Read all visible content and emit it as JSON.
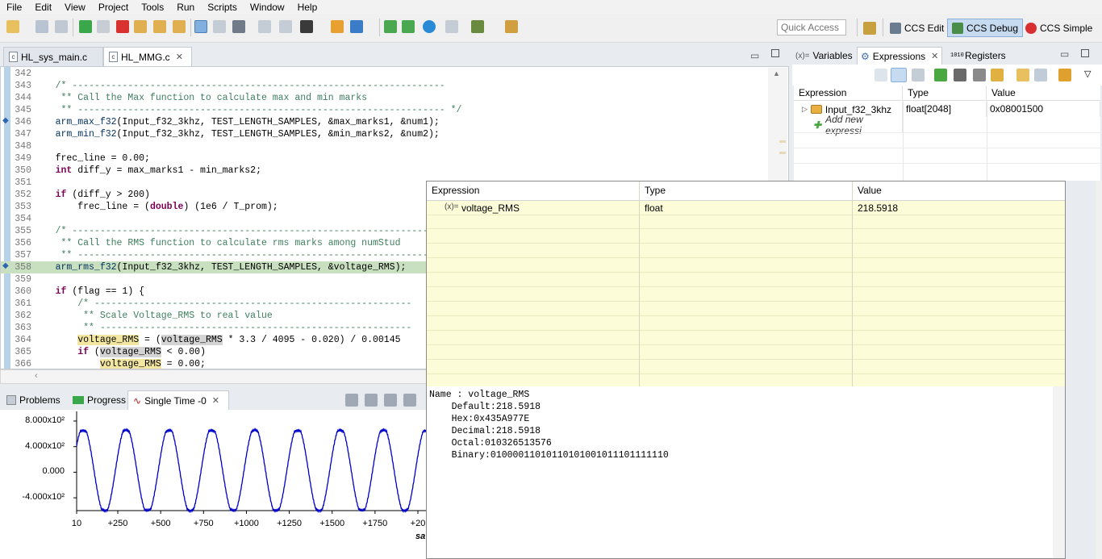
{
  "menu": [
    "File",
    "Edit",
    "View",
    "Project",
    "Tools",
    "Run",
    "Scripts",
    "Window",
    "Help"
  ],
  "toolbar": {
    "quick_access_placeholder": "Quick Access"
  },
  "perspectives": [
    {
      "label": "CCS Edit",
      "active": false
    },
    {
      "label": "CCS Debug",
      "active": true
    },
    {
      "label": "CCS Simple",
      "active": false
    }
  ],
  "editor": {
    "tabs": [
      {
        "label": "HL_sys_main.c",
        "active": false
      },
      {
        "label": "HL_MMG.c",
        "active": true
      }
    ]
  },
  "code": [
    {
      "n": "342",
      "segs": [
        {
          "t": ""
        }
      ]
    },
    {
      "n": "343",
      "segs": [
        {
          "t": "    /* -------------------------------------------------------------------",
          "c": "cmt"
        }
      ]
    },
    {
      "n": "344",
      "segs": [
        {
          "t": "     ** Call the Max function to calculate max and min marks",
          "c": "cmt"
        }
      ]
    },
    {
      "n": "345",
      "segs": [
        {
          "t": "     ** ------------------------------------------------------------------ */",
          "c": "cmt"
        }
      ]
    },
    {
      "n": "346",
      "segs": [
        {
          "t": "    arm_max_f32",
          "c": "fn"
        },
        {
          "t": "(Input_f32_3khz, TEST_LENGTH_SAMPLES, &max_marks1, &num1);"
        }
      ]
    },
    {
      "n": "347",
      "segs": [
        {
          "t": "    arm_min_f32",
          "c": "fn"
        },
        {
          "t": "(Input_f32_3khz, TEST_LENGTH_SAMPLES, &min_marks2, &num2);"
        }
      ]
    },
    {
      "n": "348",
      "segs": [
        {
          "t": ""
        }
      ]
    },
    {
      "n": "349",
      "segs": [
        {
          "t": "    frec_line = 0.00;"
        }
      ]
    },
    {
      "n": "350",
      "segs": [
        {
          "t": "    "
        },
        {
          "t": "int",
          "c": "kw"
        },
        {
          "t": " diff_y = max_marks1 - min_marks2;"
        }
      ]
    },
    {
      "n": "351",
      "segs": [
        {
          "t": ""
        }
      ]
    },
    {
      "n": "352",
      "segs": [
        {
          "t": "    "
        },
        {
          "t": "if",
          "c": "kw"
        },
        {
          "t": " (diff_y > 200)"
        }
      ]
    },
    {
      "n": "353",
      "segs": [
        {
          "t": "        frec_line = ("
        },
        {
          "t": "double",
          "c": "kw"
        },
        {
          "t": ") (1e6 / T_prom);"
        }
      ]
    },
    {
      "n": "354",
      "segs": [
        {
          "t": ""
        }
      ]
    },
    {
      "n": "355",
      "segs": [
        {
          "t": "    /* -------------------------------------------------------------------",
          "c": "cmt"
        }
      ]
    },
    {
      "n": "356",
      "segs": [
        {
          "t": "     ** Call the RMS function to calculate rms marks among numStud",
          "c": "cmt"
        }
      ]
    },
    {
      "n": "357",
      "segs": [
        {
          "t": "     ** ------------------------------------------------------------------",
          "c": "cmt"
        }
      ]
    },
    {
      "n": "358",
      "hl": true,
      "segs": [
        {
          "t": "    arm_rms_f32",
          "c": "fn"
        },
        {
          "t": "(Input_f32_3khz, TEST_LENGTH_SAMPLES, &voltage_RMS);"
        }
      ]
    },
    {
      "n": "359",
      "segs": [
        {
          "t": ""
        }
      ]
    },
    {
      "n": "360",
      "segs": [
        {
          "t": "    "
        },
        {
          "t": "if",
          "c": "kw"
        },
        {
          "t": " (flag == 1) {"
        }
      ]
    },
    {
      "n": "361",
      "segs": [
        {
          "t": "        /* ---------------------------------------------------------",
          "c": "cmt"
        }
      ]
    },
    {
      "n": "362",
      "segs": [
        {
          "t": "         ** Scale Voltage_RMS to real value",
          "c": "cmt"
        }
      ]
    },
    {
      "n": "363",
      "segs": [
        {
          "t": "         ** --------------------------------------------------------",
          "c": "cmt"
        }
      ]
    },
    {
      "n": "364",
      "segs": [
        {
          "t": "        "
        },
        {
          "t": "voltage_RMS",
          "c": "var-hl2"
        },
        {
          "t": " = ("
        },
        {
          "t": "voltage_RMS",
          "c": "var-hl"
        },
        {
          "t": " * 3.3 / 4095 - 0.020) / 0.00145"
        }
      ]
    },
    {
      "n": "365",
      "segs": [
        {
          "t": "        "
        },
        {
          "t": "if",
          "c": "kw"
        },
        {
          "t": " ("
        },
        {
          "t": "voltage_RMS",
          "c": "var-hl"
        },
        {
          "t": " < 0.00)"
        }
      ]
    },
    {
      "n": "366",
      "segs": [
        {
          "t": "            "
        },
        {
          "t": "voltage_RMS",
          "c": "var-hl2"
        },
        {
          "t": " = 0.00;"
        }
      ]
    }
  ],
  "right_panel": {
    "tabs": [
      {
        "label": "Variables",
        "prefix": "(x)="
      },
      {
        "label": "Expressions",
        "active": true
      },
      {
        "label": "Registers",
        "prefix": "1010"
      }
    ],
    "headers": [
      "Expression",
      "Type",
      "Value"
    ],
    "rows": [
      {
        "expr": "Input_f32_3khz",
        "type": "float[2048]",
        "value": "0x08001500"
      }
    ],
    "add_new": "Add new expressi"
  },
  "hover": {
    "headers": [
      "Expression",
      "Type",
      "Value"
    ],
    "row": {
      "prefix": "(x)=",
      "expr": "voltage_RMS",
      "type": "float",
      "value": "218.5918"
    },
    "detail": [
      "Name : voltage_RMS",
      "    Default:218.5918",
      "    Hex:0x435A977E",
      "    Decimal:218.5918",
      "    Octal:010326513576",
      "    Binary:01000011010110101001011101111110"
    ]
  },
  "bottom": {
    "tabs": [
      {
        "label": "Problems"
      },
      {
        "label": "Progress"
      },
      {
        "label": "Single Time -0",
        "active": true
      }
    ],
    "xlabel_fragment": "sa"
  },
  "chart_data": {
    "type": "line",
    "x_ticks": [
      "10",
      "+250",
      "+500",
      "+750",
      "+1000",
      "+1250",
      "+1500",
      "+1750",
      "+20"
    ],
    "y_ticks": [
      "8.000x10²",
      "4.000x10²",
      "0.000",
      "-4.000x10²"
    ],
    "ylim": [
      -600,
      850
    ],
    "xlim": [
      10,
      2050
    ],
    "period": 250,
    "amplitude": 680,
    "offset": 30,
    "color": "#0000c8"
  }
}
